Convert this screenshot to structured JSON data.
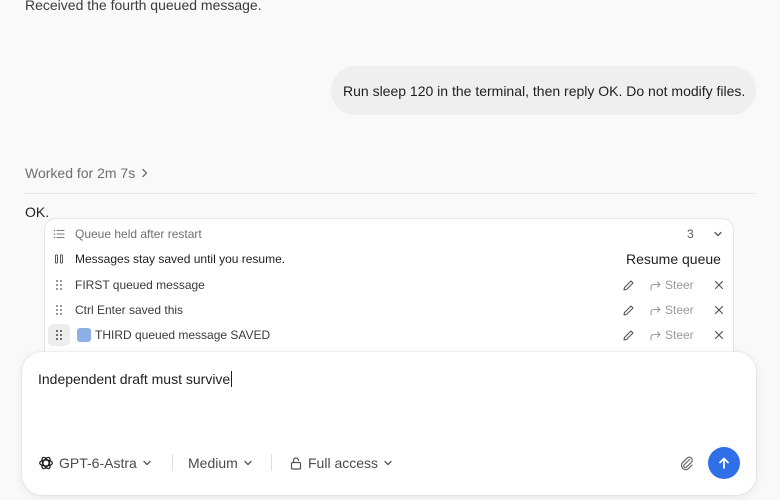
{
  "chat": {
    "previous_message": "Received the fourth queued message.",
    "user_message": "Run sleep 120 in the terminal, then reply OK. Do not modify files.",
    "worked_for": "Worked for 2m 7s",
    "assistant_reply": "OK."
  },
  "queue": {
    "title": "Queue held after restart",
    "count": "3",
    "notice": "Messages stay saved until you resume.",
    "resume_label": "Resume queue",
    "items": [
      {
        "text": "FIRST queued message",
        "steer_label": "Steer"
      },
      {
        "text": "Ctrl Enter saved this",
        "steer_label": "Steer"
      },
      {
        "text": "THIRD queued message SAVED",
        "steer_label": "Steer"
      }
    ]
  },
  "composer": {
    "draft_text": "Independent draft must survive",
    "model_label": "GPT-6-Astra",
    "reasoning_label": "Medium",
    "access_label": "Full access"
  },
  "colors": {
    "accent": "#2f6fe8",
    "item_swatch": "#8fb0e6"
  }
}
